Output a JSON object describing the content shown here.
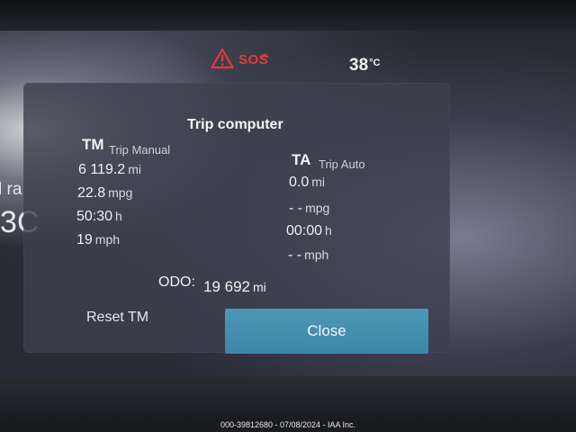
{
  "status": {
    "sos_label": "SOS",
    "temperature_value": "38",
    "temperature_unit": "°C",
    "colors": {
      "sos": "#e2393c",
      "close_button": "#4591b2"
    }
  },
  "background": {
    "rate_fragment": "l ra",
    "number_fragment": "3C"
  },
  "dialog": {
    "title": "Trip computer",
    "trip_manual": {
      "abbr": "TM",
      "label": "Trip Manual",
      "distance": {
        "value": "6 119.2",
        "unit": "mi"
      },
      "economy": {
        "value": "22.8",
        "unit": "mpg"
      },
      "time": {
        "value": "50:30",
        "unit": "h"
      },
      "speed": {
        "value": "19",
        "unit": "mph"
      }
    },
    "trip_auto": {
      "abbr": "TA",
      "label": "Trip Auto",
      "distance": {
        "value": "0.0",
        "unit": "mi"
      },
      "economy": {
        "value": "- -",
        "unit": "mpg"
      },
      "time": {
        "value": "00:00",
        "unit": "h"
      },
      "speed": {
        "value": "- -",
        "unit": "mph"
      }
    },
    "odometer": {
      "label": "ODO:",
      "value": "19 692",
      "unit": "mi"
    },
    "reset_label": "Reset TM",
    "close_label": "Close"
  },
  "watermark": "000-39812680 - 07/08/2024 - IAA Inc."
}
